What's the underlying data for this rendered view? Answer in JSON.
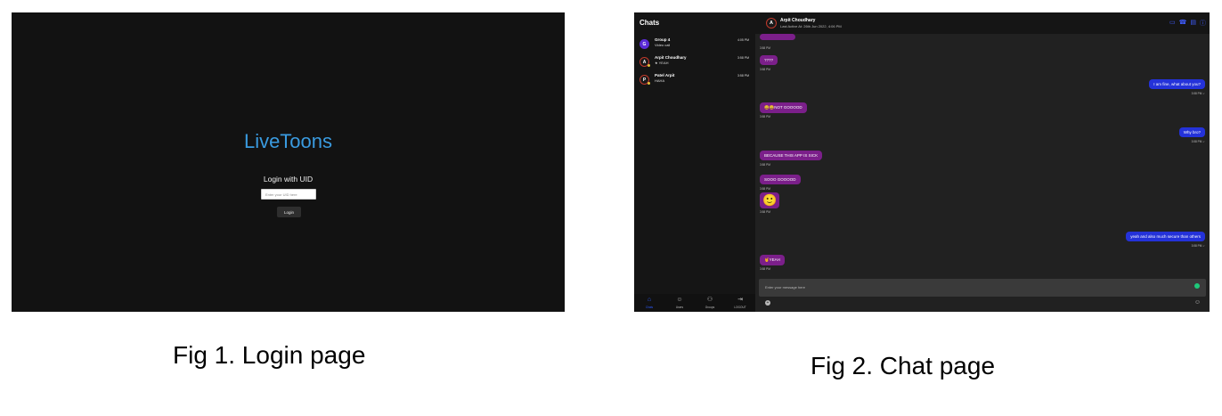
{
  "figure1": {
    "brand": "LiveToons",
    "login_title": "Login with UID",
    "uid_placeholder": "Enter your UID here",
    "login_button": "Login",
    "caption": "Fig 1. Login page"
  },
  "figure2": {
    "sidebar_title": "Chats",
    "conversations": [
      {
        "avatar": "G",
        "name": "Group 4",
        "last": "Video call",
        "time": "4:05 PM",
        "avatar_color": "#5b2bd6"
      },
      {
        "avatar": "A",
        "name": "Arpit Choudhary",
        "last": "★ YEAH",
        "time": "3:58 PM",
        "avatar_color": "#1a1a1a"
      },
      {
        "avatar": "P",
        "name": "Patel Arpit",
        "last": "HAHA",
        "time": "3:58 PM",
        "avatar_color": "#1a1a1a"
      }
    ],
    "nav": [
      {
        "icon": "⌂",
        "label": "Chats"
      },
      {
        "icon": "☺",
        "label": "Users"
      },
      {
        "icon": "⚇",
        "label": "Groups"
      },
      {
        "icon": "⇥",
        "label": "LOGOUT"
      }
    ],
    "header": {
      "avatar": "A",
      "name": "Arpit Choudhary",
      "status": "Last Active At: 26th Jun 2022, 4:06 PM",
      "icons": [
        "▭",
        "☎",
        "▤",
        "ⓘ"
      ]
    },
    "messages": [
      {
        "type": "recv",
        "text": "",
        "time": "3:58 PM"
      },
      {
        "type": "recv",
        "text": "????",
        "time": "3:58 PM"
      },
      {
        "type": "sent",
        "text": "I am fine, what about you?",
        "time": "3:58 PM ✓"
      },
      {
        "type": "recv",
        "text": "😀😀NOT GOOOOD",
        "time": "3:58 PM"
      },
      {
        "type": "sent",
        "text": "Why bro?",
        "time": "3:58 PM ✓"
      },
      {
        "type": "recv",
        "text": "BECAUSE THIS APP IS SICK",
        "time": "3:58 PM"
      },
      {
        "type": "recv",
        "text": "SOOO GOOOOD",
        "time": "3:58 PM"
      },
      {
        "type": "recv",
        "text": "🙂",
        "time": "3:58 PM",
        "big": true
      },
      {
        "type": "sent",
        "text": "yeah and also much secure than others",
        "time": "3:58 PM ✓"
      },
      {
        "type": "recv",
        "text": "🤘YEAH",
        "time": "3:58 PM"
      }
    ],
    "composer_placeholder": "Enter your message here",
    "caption": "Fig 2. Chat page"
  }
}
